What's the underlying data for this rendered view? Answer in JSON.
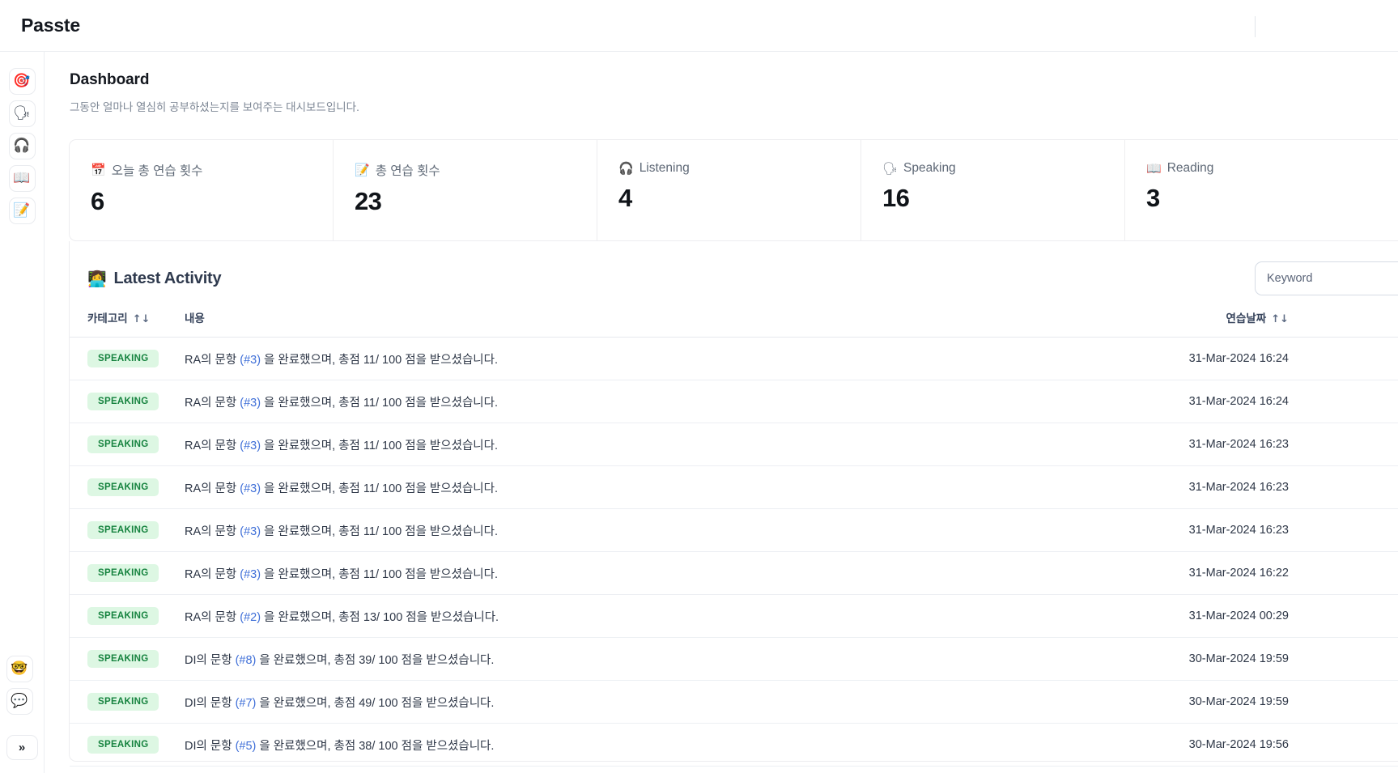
{
  "app": {
    "brand": "Passte"
  },
  "sidebar": {
    "top_items": [
      {
        "name": "dart-icon",
        "glyph": "🎯",
        "label": "Dashboard"
      },
      {
        "name": "speaking-head-icon",
        "glyph": "🗣",
        "label": "Speaking"
      },
      {
        "name": "headphone-icon",
        "glyph": "🎧",
        "label": "Listening"
      },
      {
        "name": "open-book-icon",
        "glyph": "📖",
        "label": "Reading"
      },
      {
        "name": "memo-icon",
        "glyph": "📝",
        "label": "Writing"
      }
    ],
    "bottom_items": [
      {
        "name": "nerd-face-icon",
        "glyph": "🤓",
        "label": "Profile"
      },
      {
        "name": "speech-balloon-icon",
        "glyph": "💬",
        "label": "Chat"
      }
    ],
    "expand_label": "»"
  },
  "page": {
    "title": "Dashboard",
    "subtitle": "그동안 얼마나 열심히 공부하셨는지를 보여주는 대시보드입니다."
  },
  "stats": [
    {
      "icon": "📅",
      "icon_name": "calendar-icon",
      "label": "오늘 총 연습 횟수",
      "value": "6"
    },
    {
      "icon": "📝",
      "icon_name": "memo-icon",
      "label": "총 연습 횟수",
      "value": "23"
    },
    {
      "icon": "🎧",
      "icon_name": "headphone-icon",
      "label": "Listening",
      "value": "4"
    },
    {
      "icon": "🗣",
      "icon_name": "speaking-head-icon",
      "label": "Speaking",
      "value": "16"
    },
    {
      "icon": "📖",
      "icon_name": "open-book-icon",
      "label": "Reading",
      "value": "3"
    }
  ],
  "activity": {
    "icon": "👩‍💻",
    "title": "Latest Activity",
    "search_placeholder": "Keyword",
    "search_value": "",
    "sort_icon": "↑↓",
    "columns": {
      "category": "카테고리",
      "content": "내용",
      "date": "연습날짜"
    },
    "rows": [
      {
        "category": "SPEAKING",
        "prefix": "RA의 문항 ",
        "ref": "(#3)",
        "suffix": " 을 완료했으며, 총점 11/ 100 점을 받으셨습니다.",
        "date": "31-Mar-2024 16:24"
      },
      {
        "category": "SPEAKING",
        "prefix": "RA의 문항 ",
        "ref": "(#3)",
        "suffix": " 을 완료했으며, 총점 11/ 100 점을 받으셨습니다.",
        "date": "31-Mar-2024 16:24"
      },
      {
        "category": "SPEAKING",
        "prefix": "RA의 문항 ",
        "ref": "(#3)",
        "suffix": " 을 완료했으며, 총점 11/ 100 점을 받으셨습니다.",
        "date": "31-Mar-2024 16:23"
      },
      {
        "category": "SPEAKING",
        "prefix": "RA의 문항 ",
        "ref": "(#3)",
        "suffix": " 을 완료했으며, 총점 11/ 100 점을 받으셨습니다.",
        "date": "31-Mar-2024 16:23"
      },
      {
        "category": "SPEAKING",
        "prefix": "RA의 문항 ",
        "ref": "(#3)",
        "suffix": " 을 완료했으며, 총점 11/ 100 점을 받으셨습니다.",
        "date": "31-Mar-2024 16:23"
      },
      {
        "category": "SPEAKING",
        "prefix": "RA의 문항 ",
        "ref": "(#3)",
        "suffix": " 을 완료했으며, 총점 11/ 100 점을 받으셨습니다.",
        "date": "31-Mar-2024 16:22"
      },
      {
        "category": "SPEAKING",
        "prefix": "RA의 문항 ",
        "ref": "(#2)",
        "suffix": " 을 완료했으며, 총점 13/ 100 점을 받으셨습니다.",
        "date": "31-Mar-2024 00:29"
      },
      {
        "category": "SPEAKING",
        "prefix": "DI의 문항 ",
        "ref": "(#8)",
        "suffix": " 을 완료했으며, 총점 39/ 100 점을 받으셨습니다.",
        "date": "30-Mar-2024 19:59"
      },
      {
        "category": "SPEAKING",
        "prefix": "DI의 문항 ",
        "ref": "(#7)",
        "suffix": " 을 완료했으며, 총점 49/ 100 점을 받으셨습니다.",
        "date": "30-Mar-2024 19:59"
      },
      {
        "category": "SPEAKING",
        "prefix": "DI의 문항 ",
        "ref": "(#5)",
        "suffix": " 을 완료했으며, 총점 38/ 100 점을 받으셨습니다.",
        "date": "30-Mar-2024 19:56"
      }
    ]
  },
  "colors": {
    "badge_bg": "#ddf7e3",
    "badge_text": "#16833f",
    "ref_link": "#3f6fd8",
    "muted_text": "#7c8694"
  }
}
